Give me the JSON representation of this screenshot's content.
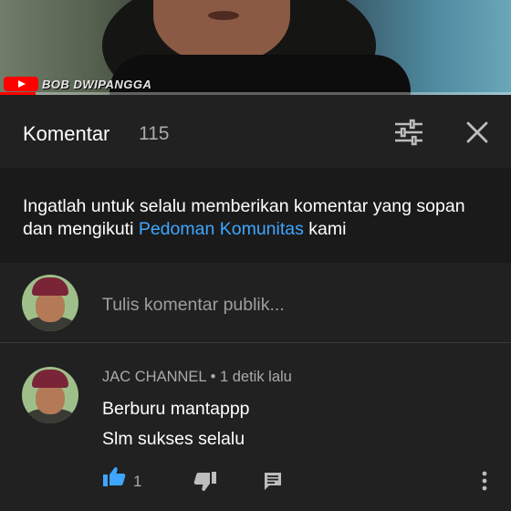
{
  "video": {
    "channel_watermark": "BOB DWIPANGGA",
    "progress": 0.07,
    "accent_color": "#ff0000"
  },
  "header": {
    "title": "Komentar",
    "count": "115",
    "filter_icon": "filter-icon",
    "close_icon": "close-icon"
  },
  "guideline": {
    "text_before": "Ingatlah untuk selalu memberikan komentar yang sopan dan mengikuti ",
    "link": "Pedoman Komunitas",
    "text_after": " kami",
    "link_color": "#3ea6ff"
  },
  "compose": {
    "placeholder": "Tulis komentar publik..."
  },
  "comment": {
    "author": "JAC CHANNEL",
    "separator": " • ",
    "time": "1 detik lalu",
    "lines": [
      "Berburu mantappp",
      "Slm sukses selalu"
    ],
    "like_count": "1",
    "like_active_color": "#3ea6ff"
  }
}
